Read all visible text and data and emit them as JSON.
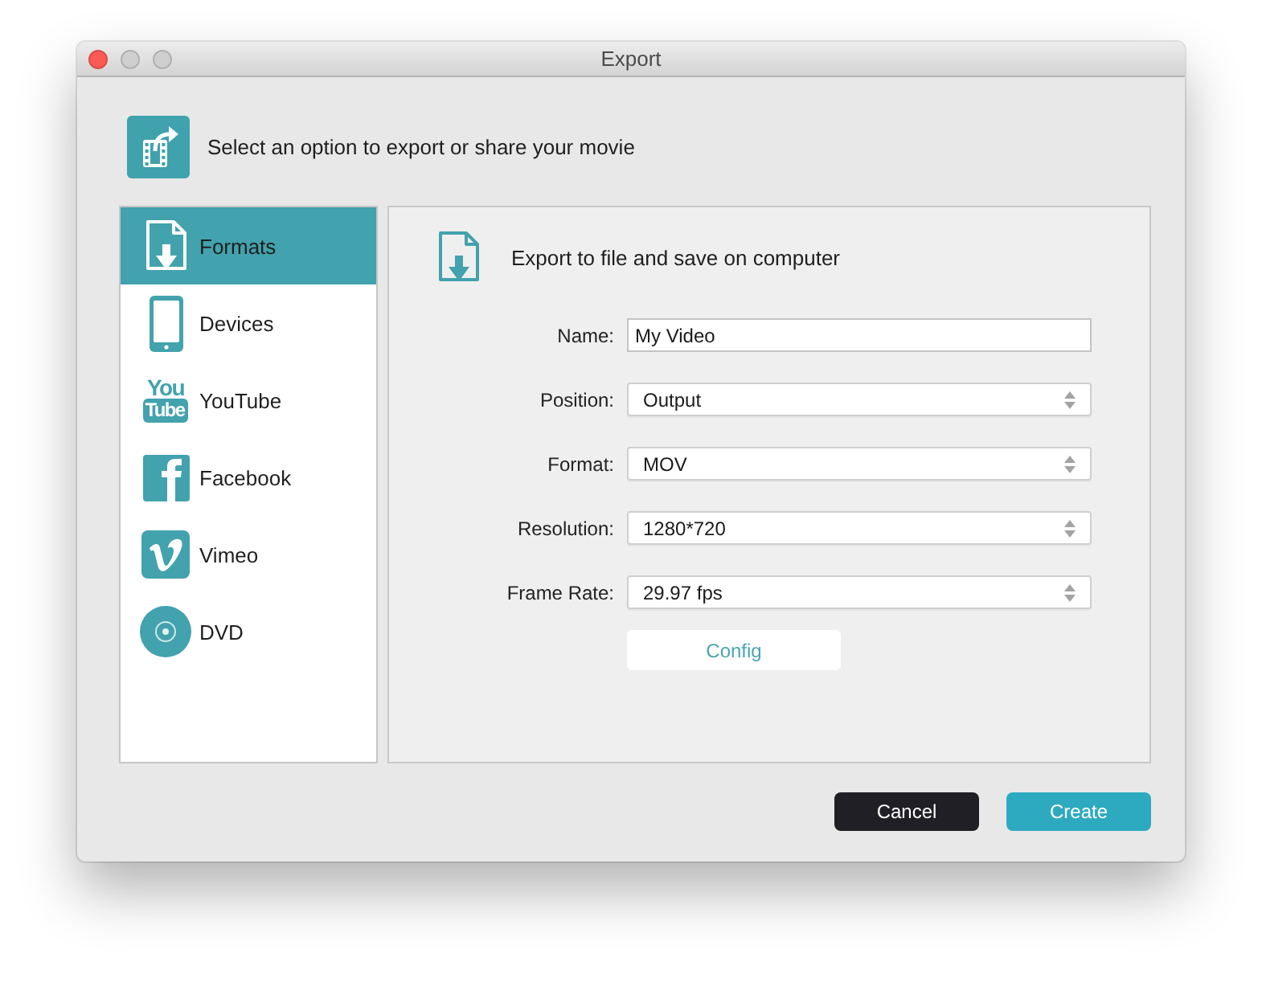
{
  "window": {
    "title": "Export",
    "controls": [
      {
        "kind": "close",
        "disabled": false
      },
      {
        "kind": "minimize",
        "disabled": true
      },
      {
        "kind": "zoom",
        "disabled": true
      }
    ]
  },
  "header": {
    "text": "Select an option to export or share your movie"
  },
  "sidebar": {
    "items": [
      {
        "label": "Formats",
        "kind": "file",
        "selected": true
      },
      {
        "label": "Devices",
        "kind": "phone",
        "selected": false
      },
      {
        "label": "YouTube",
        "kind": "youtube",
        "logo_text": [
          "You",
          "Tube"
        ],
        "selected": false
      },
      {
        "label": "Facebook",
        "kind": "facebook",
        "selected": false
      },
      {
        "label": "Vimeo",
        "kind": "vimeo",
        "selected": false
      },
      {
        "label": "DVD",
        "kind": "disc",
        "selected": false
      }
    ]
  },
  "panel": {
    "title": "Export to file and save on computer",
    "fields": [
      {
        "label": "Name:",
        "kind": "text",
        "value": "My Video"
      },
      {
        "label": "Position:",
        "kind": "select",
        "value": "Output"
      },
      {
        "label": "Format:",
        "kind": "select",
        "value": "MOV"
      },
      {
        "label": "Resolution:",
        "kind": "select",
        "value": "1280*720"
      },
      {
        "label": "Frame Rate:",
        "kind": "select",
        "value": "29.97 fps"
      }
    ],
    "config_button": "Config"
  },
  "buttons": [
    {
      "label": "Cancel",
      "kind": "cancel"
    },
    {
      "label": "Create",
      "kind": "confirm"
    }
  ]
}
